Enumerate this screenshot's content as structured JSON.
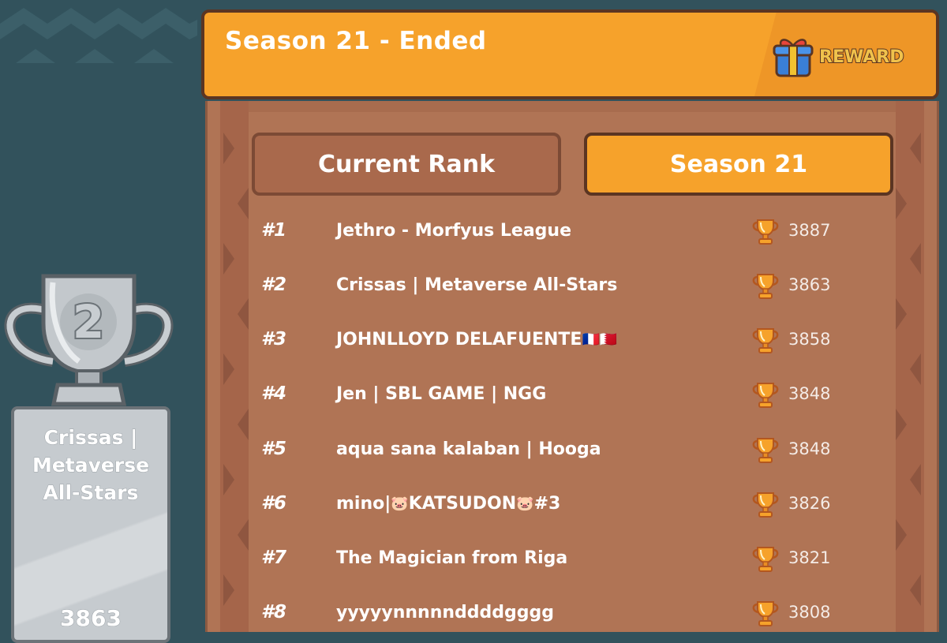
{
  "header": {
    "title": "Season 21 - Ended",
    "reward_label": "REWARD"
  },
  "tabs": {
    "current_rank": "Current Rank",
    "season": "Season 21",
    "active": "season"
  },
  "leaderboard": [
    {
      "rank": "#1",
      "name": "Jethro - Morfyus League",
      "score": "3887"
    },
    {
      "rank": "#2",
      "name": "Crissas | Metaverse All-Stars",
      "score": "3863"
    },
    {
      "rank": "#3",
      "name": "JOHNLLOYD DELAFUENTE",
      "name_suffix": "🇫🇷🇧🇭",
      "score": "3858"
    },
    {
      "rank": "#4",
      "name": "Jen | SBL GAME | NGG",
      "score": "3848"
    },
    {
      "rank": "#5",
      "name": "aqua sana kalaban | Hooga",
      "score": "3848"
    },
    {
      "rank": "#6",
      "name_a": "mino|",
      "emoji_a": "🐷",
      "name_b": "KATSUDON",
      "emoji_b": "🐷",
      "name_c": "#3",
      "score": "3826"
    },
    {
      "rank": "#7",
      "name": "The Magician from Riga",
      "score": "3821"
    },
    {
      "rank": "#8",
      "name": "yyyyynnnnnddddgggg",
      "score": "3808"
    }
  ],
  "podium": {
    "trophy_number": "2",
    "name": "Crissas | Metaverse All-Stars",
    "name_lines": [
      "Crissas |",
      "Metaverse",
      "All-Stars"
    ],
    "score": "3863"
  },
  "colors": {
    "accent": "#f6a22b",
    "board": "#b07455",
    "background": "#32525c",
    "outline": "#5b3522"
  },
  "icons": {
    "reward": "gift-icon",
    "score": "trophy-icon",
    "podium": "silver-trophy-icon"
  }
}
